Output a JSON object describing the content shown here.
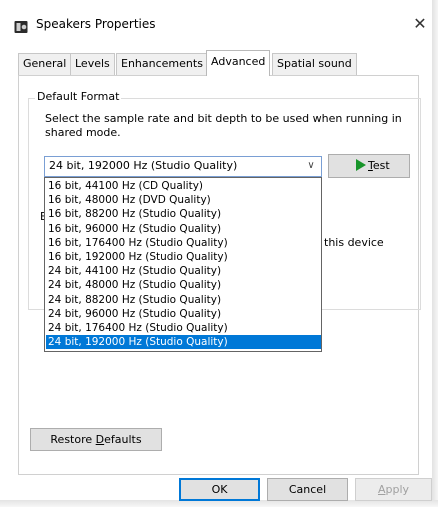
{
  "window": {
    "title": "Speakers Properties",
    "icon": "speaker-icon",
    "close_symbol": "✕"
  },
  "tabs": [
    {
      "label": "General",
      "active": false
    },
    {
      "label": "Levels",
      "active": false
    },
    {
      "label": "Enhancements",
      "active": false
    },
    {
      "label": "Advanced",
      "active": true
    },
    {
      "label": "Spatial sound",
      "active": false
    }
  ],
  "default_format": {
    "group_title": "Default Format",
    "description": "Select the sample rate and bit depth to be used when running in shared mode.",
    "selected": "24 bit, 192000 Hz (Studio Quality)",
    "test_button_mnemonic": "T",
    "test_button_rest": "est",
    "options": [
      "16 bit, 44100 Hz (CD Quality)",
      "16 bit, 48000 Hz (DVD Quality)",
      "16 bit, 88200 Hz (Studio Quality)",
      "16 bit, 96000 Hz (Studio Quality)",
      "16 bit, 176400 Hz (Studio Quality)",
      "16 bit, 192000 Hz (Studio Quality)",
      "24 bit, 44100 Hz (Studio Quality)",
      "24 bit, 48000 Hz (Studio Quality)",
      "24 bit, 88200 Hz (Studio Quality)",
      "24 bit, 96000 Hz (Studio Quality)",
      "24 bit, 176400 Hz (Studio Quality)",
      "24 bit, 192000 Hz (Studio Quality)"
    ],
    "selected_index": 11
  },
  "background": {
    "partial_group_letter": "E",
    "partial_text": "this device"
  },
  "buttons": {
    "restore_prefix": "Restore ",
    "restore_mnemonic": "D",
    "restore_rest": "efaults",
    "ok": "OK",
    "cancel": "Cancel",
    "apply_mnemonic": "A",
    "apply_rest": "pply"
  },
  "colors": {
    "selection": "#0078d7",
    "play_icon": "#18952a"
  }
}
